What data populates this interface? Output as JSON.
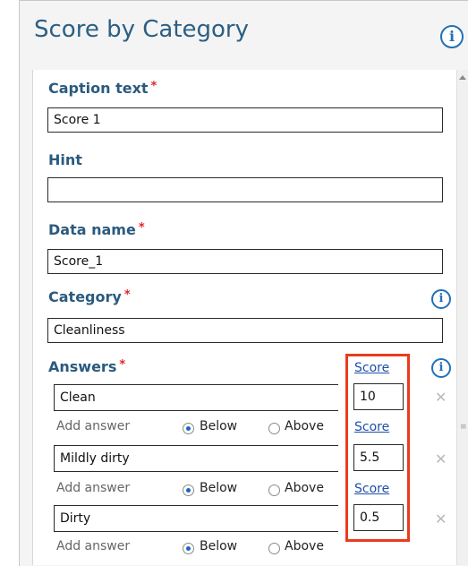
{
  "panel": {
    "title": "Score by Category"
  },
  "form": {
    "caption": {
      "label": "Caption text",
      "required": "*",
      "value": "Score 1"
    },
    "hint": {
      "label": "Hint",
      "value": ""
    },
    "data_name": {
      "label": "Data name",
      "required": "*",
      "value": "Score_1"
    },
    "category": {
      "label": "Category",
      "required": "*",
      "value": "Cleanliness"
    },
    "answers": {
      "label": "Answers",
      "required": "*",
      "items": [
        {
          "answer": "Clean",
          "score_label": "Score",
          "score": "10",
          "add_label": "Add answer",
          "below": "Below",
          "above": "Above",
          "selected": "Below"
        },
        {
          "answer": "Mildly dirty",
          "score_label": "Score",
          "score": "5.5",
          "add_label": "Add answer",
          "below": "Below",
          "above": "Above",
          "selected": "Below"
        },
        {
          "answer": "Dirty",
          "score_label": "Score",
          "score": "0.5",
          "add_label": "Add answer",
          "below": "Below",
          "above": "Above",
          "selected": "Below"
        }
      ]
    }
  },
  "icons": {
    "info": "i",
    "remove": "✕"
  },
  "colors": {
    "title": "#2c5f84",
    "label": "#2b5a7e",
    "required": "#e0242b",
    "score_link": "#1e4fa8",
    "highlight": "#ea3b1e",
    "info_icon": "#2270b8"
  }
}
